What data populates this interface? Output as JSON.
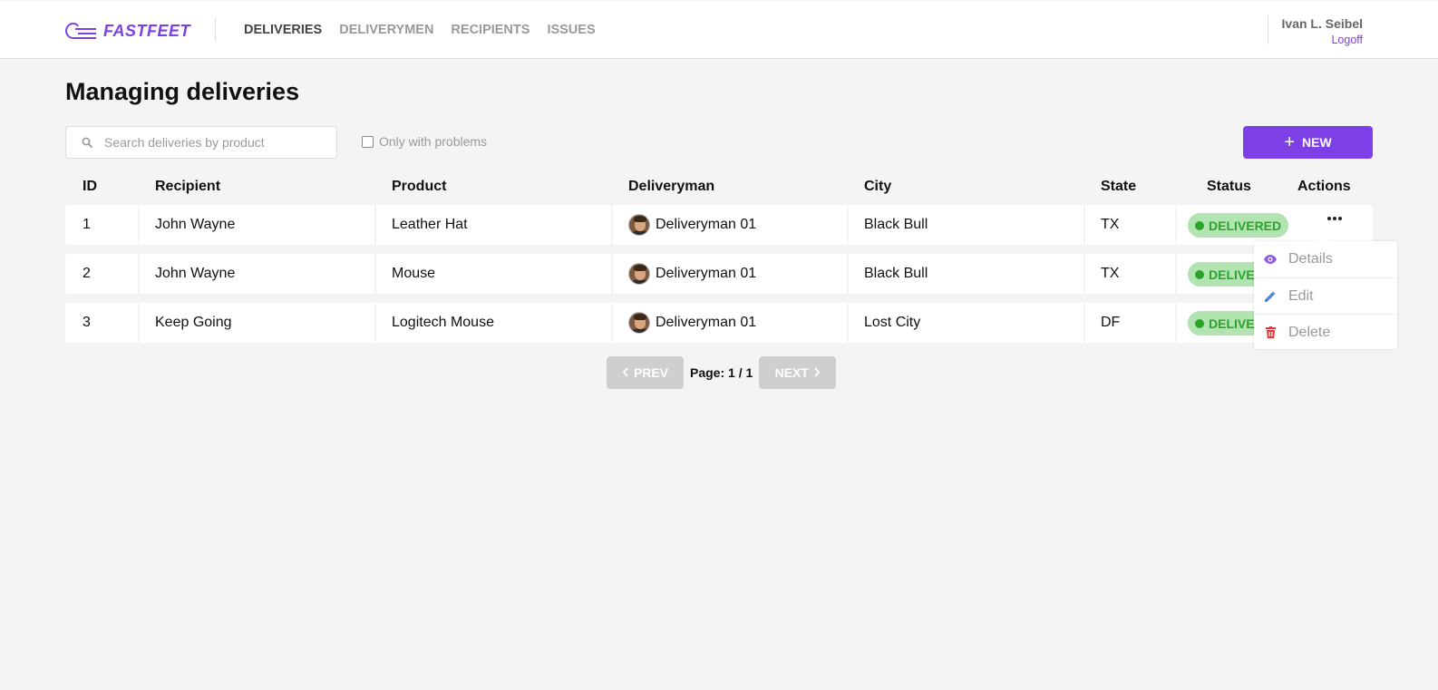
{
  "app": {
    "logo_text": "FASTFEET",
    "brand_color": "#7d40e7"
  },
  "nav": {
    "items": [
      {
        "label": "DELIVERIES",
        "active": true
      },
      {
        "label": "DELIVERYMEN",
        "active": false
      },
      {
        "label": "RECIPIENTS",
        "active": false
      },
      {
        "label": "ISSUES",
        "active": false
      }
    ]
  },
  "user": {
    "name": "Ivan L. Seibel",
    "logoff_label": "Logoff"
  },
  "page": {
    "title": "Managing deliveries"
  },
  "toolbar": {
    "search_placeholder": "Search deliveries by product",
    "filter_label": "Only with problems",
    "filter_checked": false,
    "new_button_label": "NEW"
  },
  "table": {
    "columns": [
      "ID",
      "Recipient",
      "Product",
      "Deliveryman",
      "City",
      "State",
      "Status",
      "Actions"
    ],
    "rows": [
      {
        "id": "1",
        "recipient": "John Wayne",
        "product": "Leather Hat",
        "deliveryman": "Deliveryman 01",
        "city": "Black Bull",
        "state": "TX",
        "status": "DELIVERED"
      },
      {
        "id": "2",
        "recipient": "John Wayne",
        "product": "Mouse",
        "deliveryman": "Deliveryman 01",
        "city": "Black Bull",
        "state": "TX",
        "status": "DELIVERED"
      },
      {
        "id": "3",
        "recipient": "Keep Going",
        "product": "Logitech Mouse",
        "deliveryman": "Deliveryman 01",
        "city": "Lost City",
        "state": "DF",
        "status": "DELIVERED"
      }
    ]
  },
  "actions_menu": {
    "items": [
      {
        "label": "Details",
        "icon": "eye-icon",
        "color": "#8e5be8"
      },
      {
        "label": "Edit",
        "icon": "pencil-icon",
        "color": "#4d85ee"
      },
      {
        "label": "Delete",
        "icon": "trash-icon",
        "color": "#de3b3b"
      }
    ]
  },
  "pagination": {
    "prev_label": "PREV",
    "next_label": "NEXT",
    "page_text": "Page: 1 / 1"
  },
  "status_colors": {
    "delivered_bg": "#b1e4b0",
    "delivered_fg": "#2ca42b"
  }
}
